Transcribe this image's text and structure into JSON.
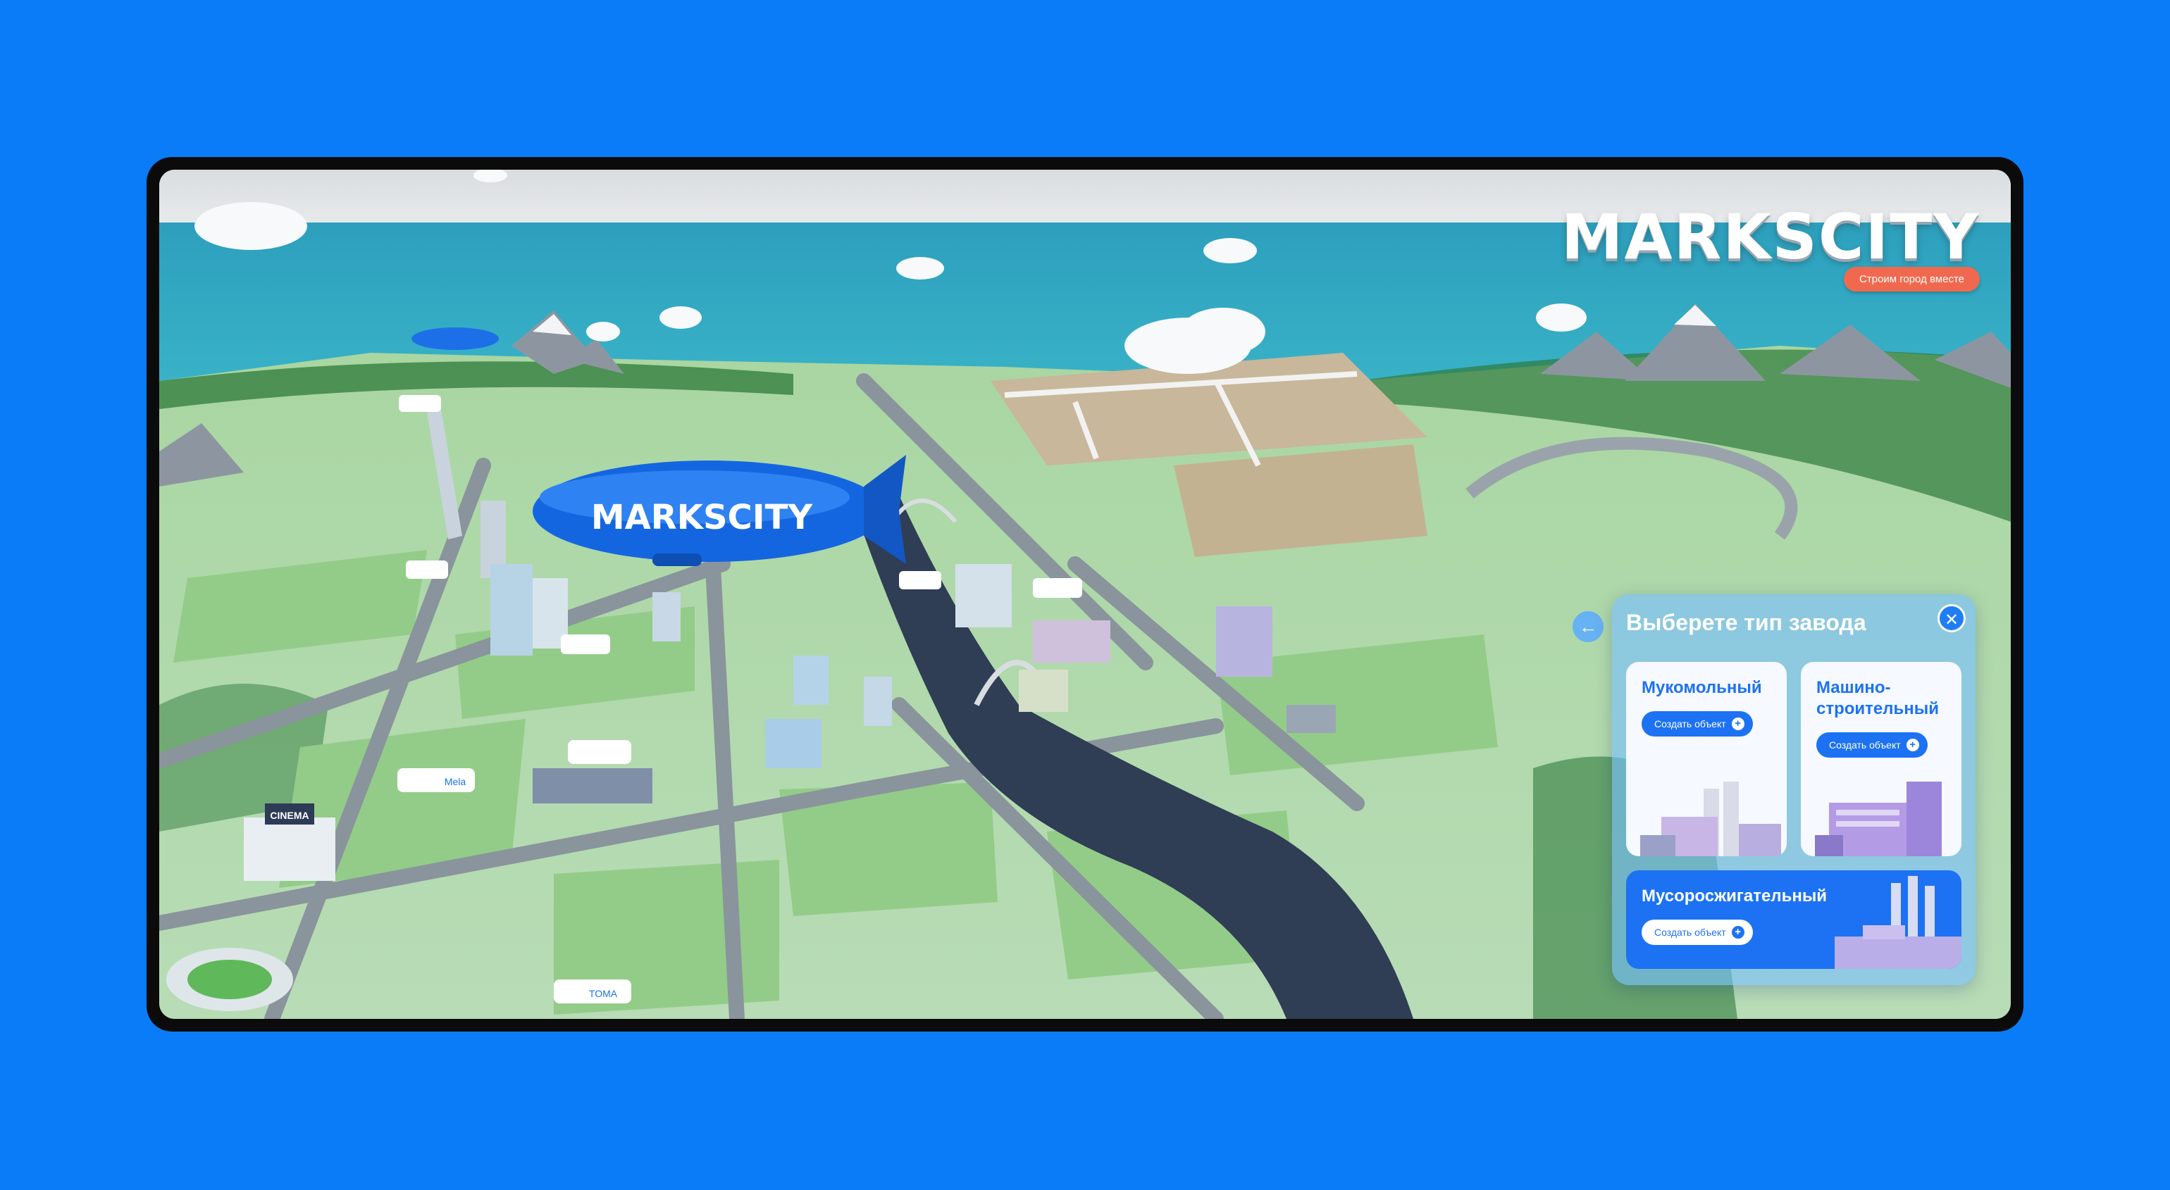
{
  "app": {
    "logo": "MARKSCITY",
    "tagline": "Строим город вместе",
    "airship_label": "MARKSCITY"
  },
  "city_signs": {
    "cinema": "CINEMA",
    "sign_1": "Mela",
    "sign_2": "TOMA"
  },
  "factory_panel": {
    "title": "Выберете тип завода",
    "back_icon": "arrow-left-icon",
    "close_icon": "close-icon",
    "cards": [
      {
        "title": "Мукомольный",
        "button": "Создать объект"
      },
      {
        "title": "Машино-\nстроительный",
        "button": "Создать объект"
      },
      {
        "title": "Мусоросжигательный",
        "button": "Создать объект"
      }
    ]
  },
  "colors": {
    "background": "#0a7cf7",
    "accent": "#1c72f2",
    "tagline": "#f0694f",
    "sea": "#3aa9c4",
    "grass": "#8fc98a"
  }
}
